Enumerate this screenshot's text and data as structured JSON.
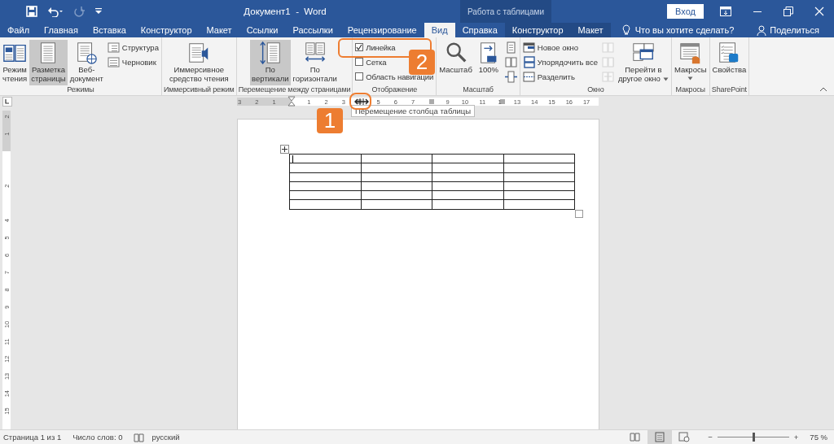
{
  "title_bar": {
    "title": "Документ1  -  Word",
    "context_title": "Работа с таблицами",
    "sign_in": "Вход"
  },
  "tabs": [
    {
      "label": "Файл",
      "kind": "main",
      "selected": false
    },
    {
      "label": "Главная",
      "kind": "main",
      "selected": false
    },
    {
      "label": "Вставка",
      "kind": "main",
      "selected": false
    },
    {
      "label": "Конструктор",
      "kind": "main",
      "selected": false
    },
    {
      "label": "Макет",
      "kind": "main",
      "selected": false
    },
    {
      "label": "Ссылки",
      "kind": "main",
      "selected": false
    },
    {
      "label": "Рассылки",
      "kind": "main",
      "selected": false
    },
    {
      "label": "Рецензирование",
      "kind": "main",
      "selected": false
    },
    {
      "label": "Вид",
      "kind": "main",
      "selected": true
    },
    {
      "label": "Справка",
      "kind": "main",
      "selected": false
    },
    {
      "label": "Конструктор",
      "kind": "context",
      "selected": false
    },
    {
      "label": "Макет",
      "kind": "context",
      "selected": false
    }
  ],
  "tell_me": "Что вы хотите сделать?",
  "share": "Поделиться",
  "ribbon": {
    "groups": [
      {
        "label": "Режимы",
        "items": [
          {
            "kind": "large",
            "label": "Режим\nчтения",
            "selected": false
          },
          {
            "kind": "large",
            "label": "Разметка\nстраницы",
            "selected": true
          },
          {
            "kind": "large",
            "label": "Веб-\nдокумент",
            "selected": false
          },
          {
            "kind": "small",
            "label": "Структура"
          },
          {
            "kind": "small",
            "label": "Черновик"
          }
        ]
      },
      {
        "label": "Иммерсивный режим",
        "items": [
          {
            "kind": "large",
            "label": "Иммерсивное\nсредство чтения"
          }
        ]
      },
      {
        "label": "Перемещение между страницами",
        "items": [
          {
            "kind": "large",
            "label": "По\nвертикали",
            "selected": true
          },
          {
            "kind": "large",
            "label": "По\nгоризонтали",
            "selected": false
          }
        ]
      },
      {
        "label": "Отображение",
        "items": [
          {
            "kind": "check",
            "label": "Линейка",
            "checked": true
          },
          {
            "kind": "check",
            "label": "Сетка",
            "checked": false
          },
          {
            "kind": "check",
            "label": "Область навигации",
            "checked": false
          }
        ]
      },
      {
        "label": "Масштаб",
        "items": [
          {
            "kind": "large",
            "label": "Масштаб"
          },
          {
            "kind": "large",
            "label": "100%"
          },
          {
            "kind": "icon",
            "disabled": false
          },
          {
            "kind": "icon",
            "disabled": false
          },
          {
            "kind": "icon",
            "disabled": false
          }
        ]
      },
      {
        "label": "Окно",
        "items": [
          {
            "kind": "small",
            "label": "Новое окно"
          },
          {
            "kind": "small",
            "label": "Упорядочить все"
          },
          {
            "kind": "small",
            "label": "Разделить"
          },
          {
            "kind": "icon",
            "disabled": true
          },
          {
            "kind": "icon",
            "disabled": true
          },
          {
            "kind": "icon",
            "disabled": true
          },
          {
            "kind": "large",
            "label": "Перейти в\nдругое окно",
            "dropdown": true
          }
        ]
      },
      {
        "label": "Макросы",
        "items": [
          {
            "kind": "large",
            "label": "Макросы",
            "dropdown": true
          }
        ]
      },
      {
        "label": "SharePoint",
        "items": [
          {
            "kind": "large",
            "label": "Свойства"
          }
        ]
      }
    ]
  },
  "ruler": {
    "labels": [
      "3",
      "2",
      "1",
      "1",
      "2",
      "3",
      "5",
      "6",
      "7",
      "9",
      "10",
      "11",
      "1",
      "13",
      "14",
      "15",
      "16",
      "17"
    ]
  },
  "vertical_ruler": {
    "labels": [
      "2",
      "1",
      "2",
      "4",
      "5",
      "6",
      "7",
      "8",
      "9",
      "10",
      "11",
      "12",
      "13",
      "14",
      "15"
    ]
  },
  "tooltip": "Перемещение столбца таблицы",
  "table": {
    "rows": [
      {
        "cells": [
          {
            "kind": "cursor"
          },
          {
            "kind": "empty"
          },
          {
            "kind": "empty"
          },
          {
            "kind": "empty"
          }
        ]
      },
      {
        "cells": [
          {
            "kind": "empty"
          },
          {
            "kind": "empty"
          },
          {
            "kind": "empty"
          },
          {
            "kind": "empty"
          }
        ]
      },
      {
        "cells": [
          {
            "kind": "empty"
          },
          {
            "kind": "empty"
          },
          {
            "kind": "empty"
          },
          {
            "kind": "empty"
          }
        ]
      },
      {
        "cells": [
          {
            "kind": "empty"
          },
          {
            "kind": "empty"
          },
          {
            "kind": "empty"
          },
          {
            "kind": "empty"
          }
        ]
      },
      {
        "cells": [
          {
            "kind": "empty"
          },
          {
            "kind": "empty"
          },
          {
            "kind": "empty"
          },
          {
            "kind": "empty"
          }
        ]
      },
      {
        "cells": [
          {
            "kind": "empty"
          },
          {
            "kind": "empty"
          },
          {
            "kind": "empty"
          },
          {
            "kind": "empty"
          }
        ]
      }
    ]
  },
  "annotations": [
    {
      "text": "1"
    },
    {
      "text": "2"
    }
  ],
  "status_bar": {
    "page": "Страница 1 из 1",
    "words": "Число слов: 0",
    "language": "русский",
    "views": [
      {
        "selected": false
      },
      {
        "selected": true
      },
      {
        "selected": false
      }
    ],
    "zoom_out": "−",
    "zoom": {
      "level": 0.5
    },
    "zoom_in": "+",
    "zoom_value": "75 %"
  }
}
